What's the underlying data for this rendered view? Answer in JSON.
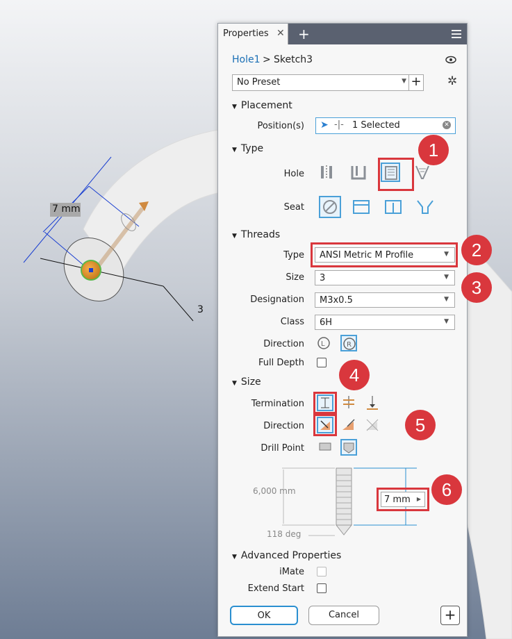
{
  "viewport": {
    "dim_label": "7 mm",
    "sketch_label": "3"
  },
  "panel": {
    "tab_title": "Properties",
    "breadcrumb_hole": "Hole1",
    "breadcrumb_sep": ">",
    "breadcrumb_sketch": "Sketch3",
    "preset": "No Preset",
    "placement": {
      "header": "Placement",
      "position_label": "Position(s)",
      "position_value": "1 Selected"
    },
    "type": {
      "header": "Type",
      "hole_label": "Hole",
      "seat_label": "Seat"
    },
    "threads": {
      "header": "Threads",
      "type_label": "Type",
      "type_value": "ANSI Metric M Profile",
      "size_label": "Size",
      "size_value": "3",
      "designation_label": "Designation",
      "designation_value": "M3x0.5",
      "class_label": "Class",
      "class_value": "6H",
      "direction_label": "Direction",
      "fulldepth_label": "Full Depth"
    },
    "size": {
      "header": "Size",
      "termination_label": "Termination",
      "direction_label": "Direction",
      "drillpoint_label": "Drill Point",
      "depth_value": "6,000 mm",
      "diameter_value": "7 mm",
      "angle_value": "118 deg"
    },
    "advanced": {
      "header": "Advanced Properties",
      "imate_label": "iMate",
      "extend_label": "Extend Start"
    },
    "ok_label": "OK",
    "cancel_label": "Cancel"
  },
  "callouts": [
    "1",
    "2",
    "3",
    "4",
    "5",
    "6"
  ],
  "colors": {
    "accent": "#4aa0d8",
    "callout": "#d9373d",
    "link": "#1a6fb5"
  }
}
